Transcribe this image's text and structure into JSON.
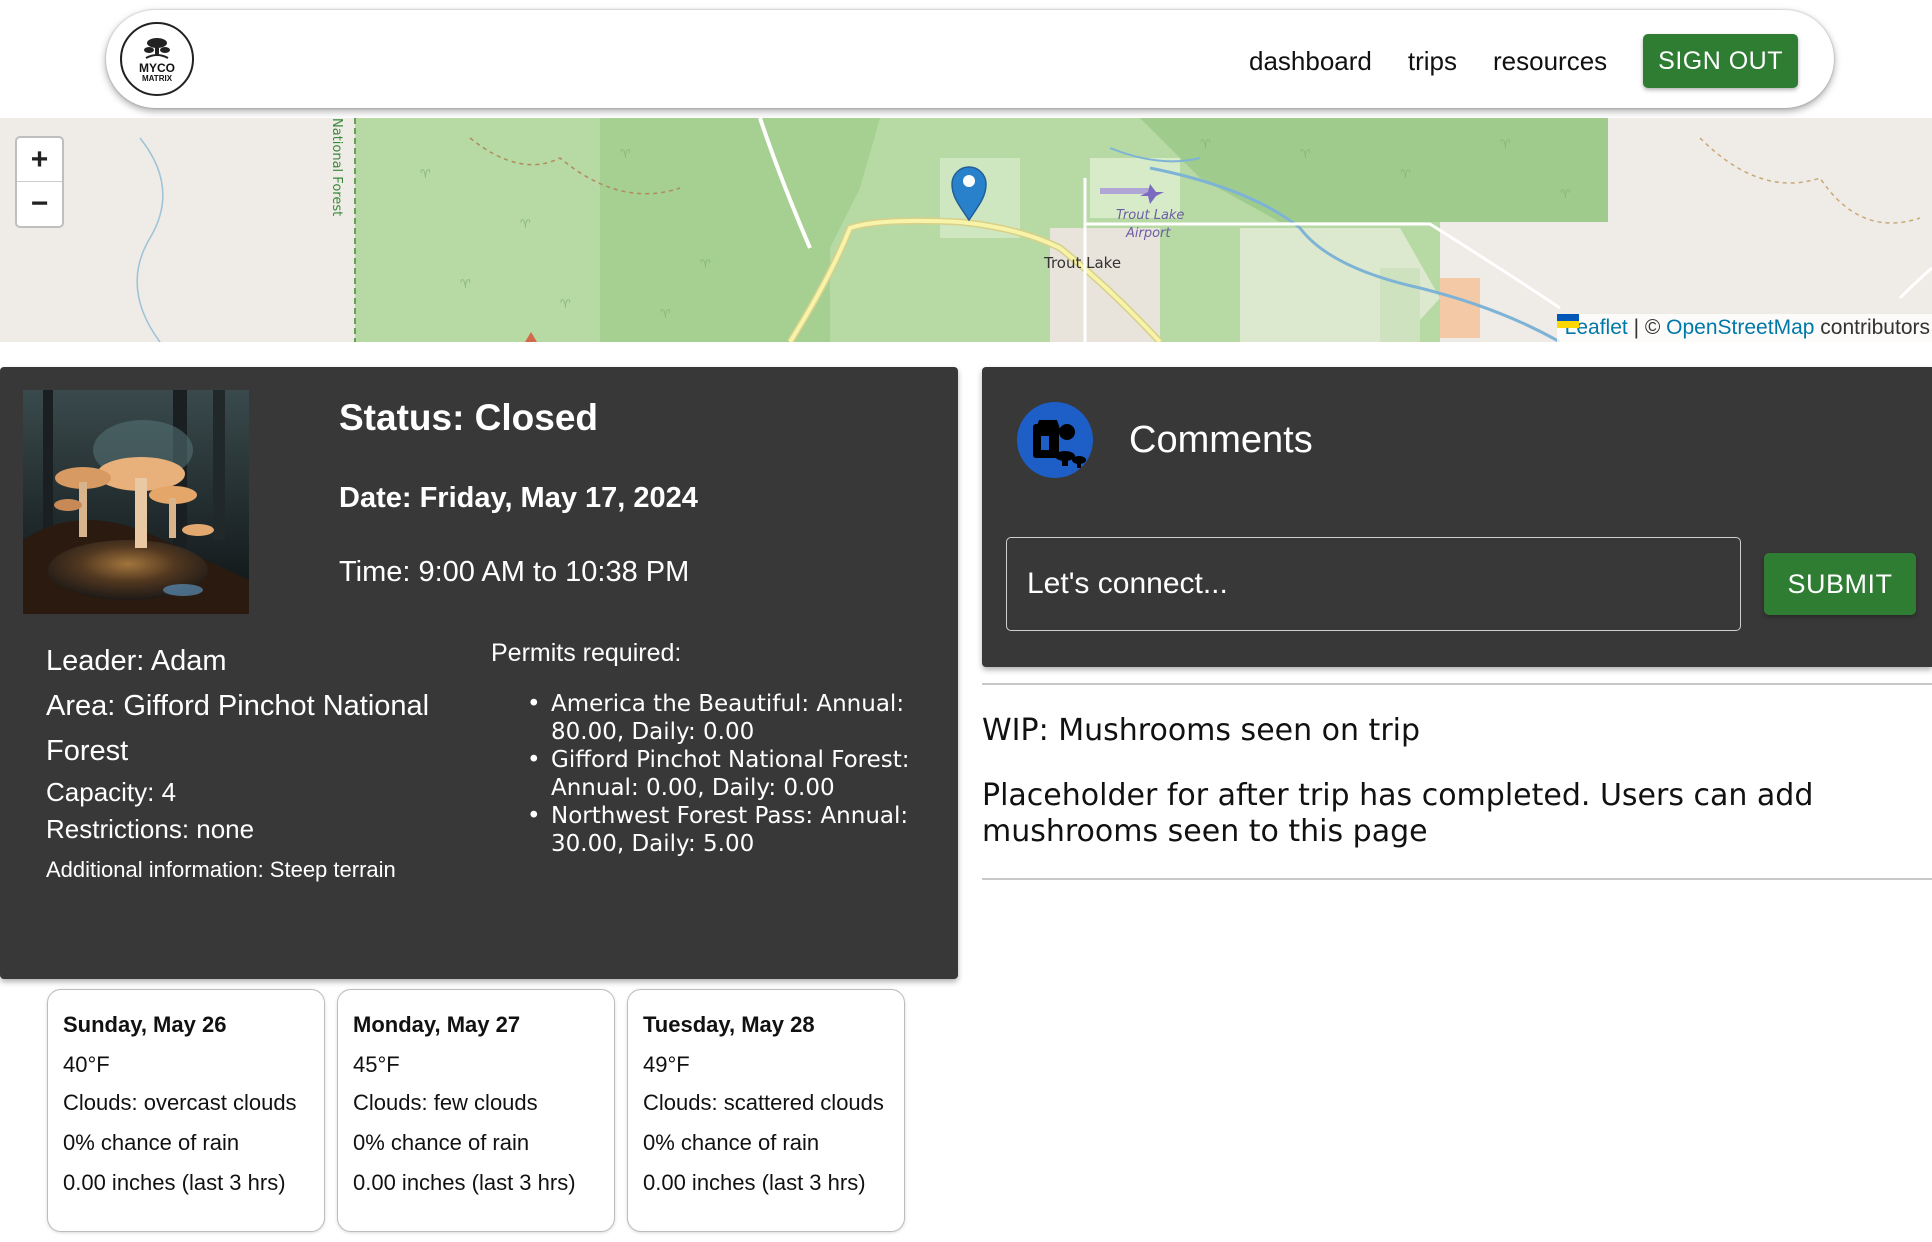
{
  "nav": {
    "logo_text": "MYCO",
    "logo_subtext": "MATRIX",
    "links": [
      "dashboard",
      "trips",
      "resources"
    ],
    "signout_label": "SIGN OUT"
  },
  "map": {
    "zoom_in": "+",
    "zoom_out": "−",
    "labels": {
      "national_forest": "National Forest",
      "trout_lake_airport_1": "Trout Lake",
      "trout_lake_airport_2": "Airport",
      "trout_lake": "Trout Lake"
    },
    "attribution": {
      "leaflet": "Leaflet",
      "separator": " | © ",
      "osm": "OpenStreetMap",
      "contributors": " contributors"
    },
    "icons": [
      "map-marker-icon",
      "airport-icon",
      "ukraine-flag-icon"
    ]
  },
  "trip": {
    "status": "Status: Closed",
    "date": "Date: Friday, May 17, 2024",
    "time": "Time: 9:00 AM to 10:38 PM",
    "leader": "Leader: Adam",
    "area_line1": "Area: Gifford Pinchot National",
    "area_line2": "Forest",
    "capacity": "Capacity: 4",
    "restrictions": "Restrictions: none",
    "additional": "Additional information: Steep terrain",
    "permits_title": "Permits required:",
    "permits": [
      "America the Beautiful: Annual: 80.00, Daily: 0.00",
      "Gifford Pinchot National Forest: Annual: 0.00, Daily: 0.00",
      "Northwest Forest Pass: Annual: 30.00, Daily: 5.00"
    ]
  },
  "comments": {
    "title": "Comments",
    "placeholder": "Let's connect...",
    "submit_label": "SUBMIT"
  },
  "mushrooms": {
    "heading": "WIP: Mushrooms seen on trip",
    "placeholder": "Placeholder for after trip has completed. Users can add mushrooms seen to this page"
  },
  "weather": [
    {
      "day": "Sunday, May 26",
      "temp": "40°F",
      "clouds": "Clouds: overcast clouds",
      "rain_chance": "0% chance of rain",
      "rain_amount": "0.00 inches (last 3 hrs)"
    },
    {
      "day": "Monday, May 27",
      "temp": "45°F",
      "clouds": "Clouds: few clouds",
      "rain_chance": "0% chance of rain",
      "rain_amount": "0.00 inches (last 3 hrs)"
    },
    {
      "day": "Tuesday, May 28",
      "temp": "49°F",
      "clouds": "Clouds: scattered clouds",
      "rain_chance": "0% chance of rain",
      "rain_amount": "0.00 inches (last 3 hrs)"
    }
  ],
  "colors": {
    "accent_green": "#2e7d32",
    "card_dark": "#383838",
    "avatar_blue": "#1e5ec7",
    "link_blue": "#0078a8"
  }
}
